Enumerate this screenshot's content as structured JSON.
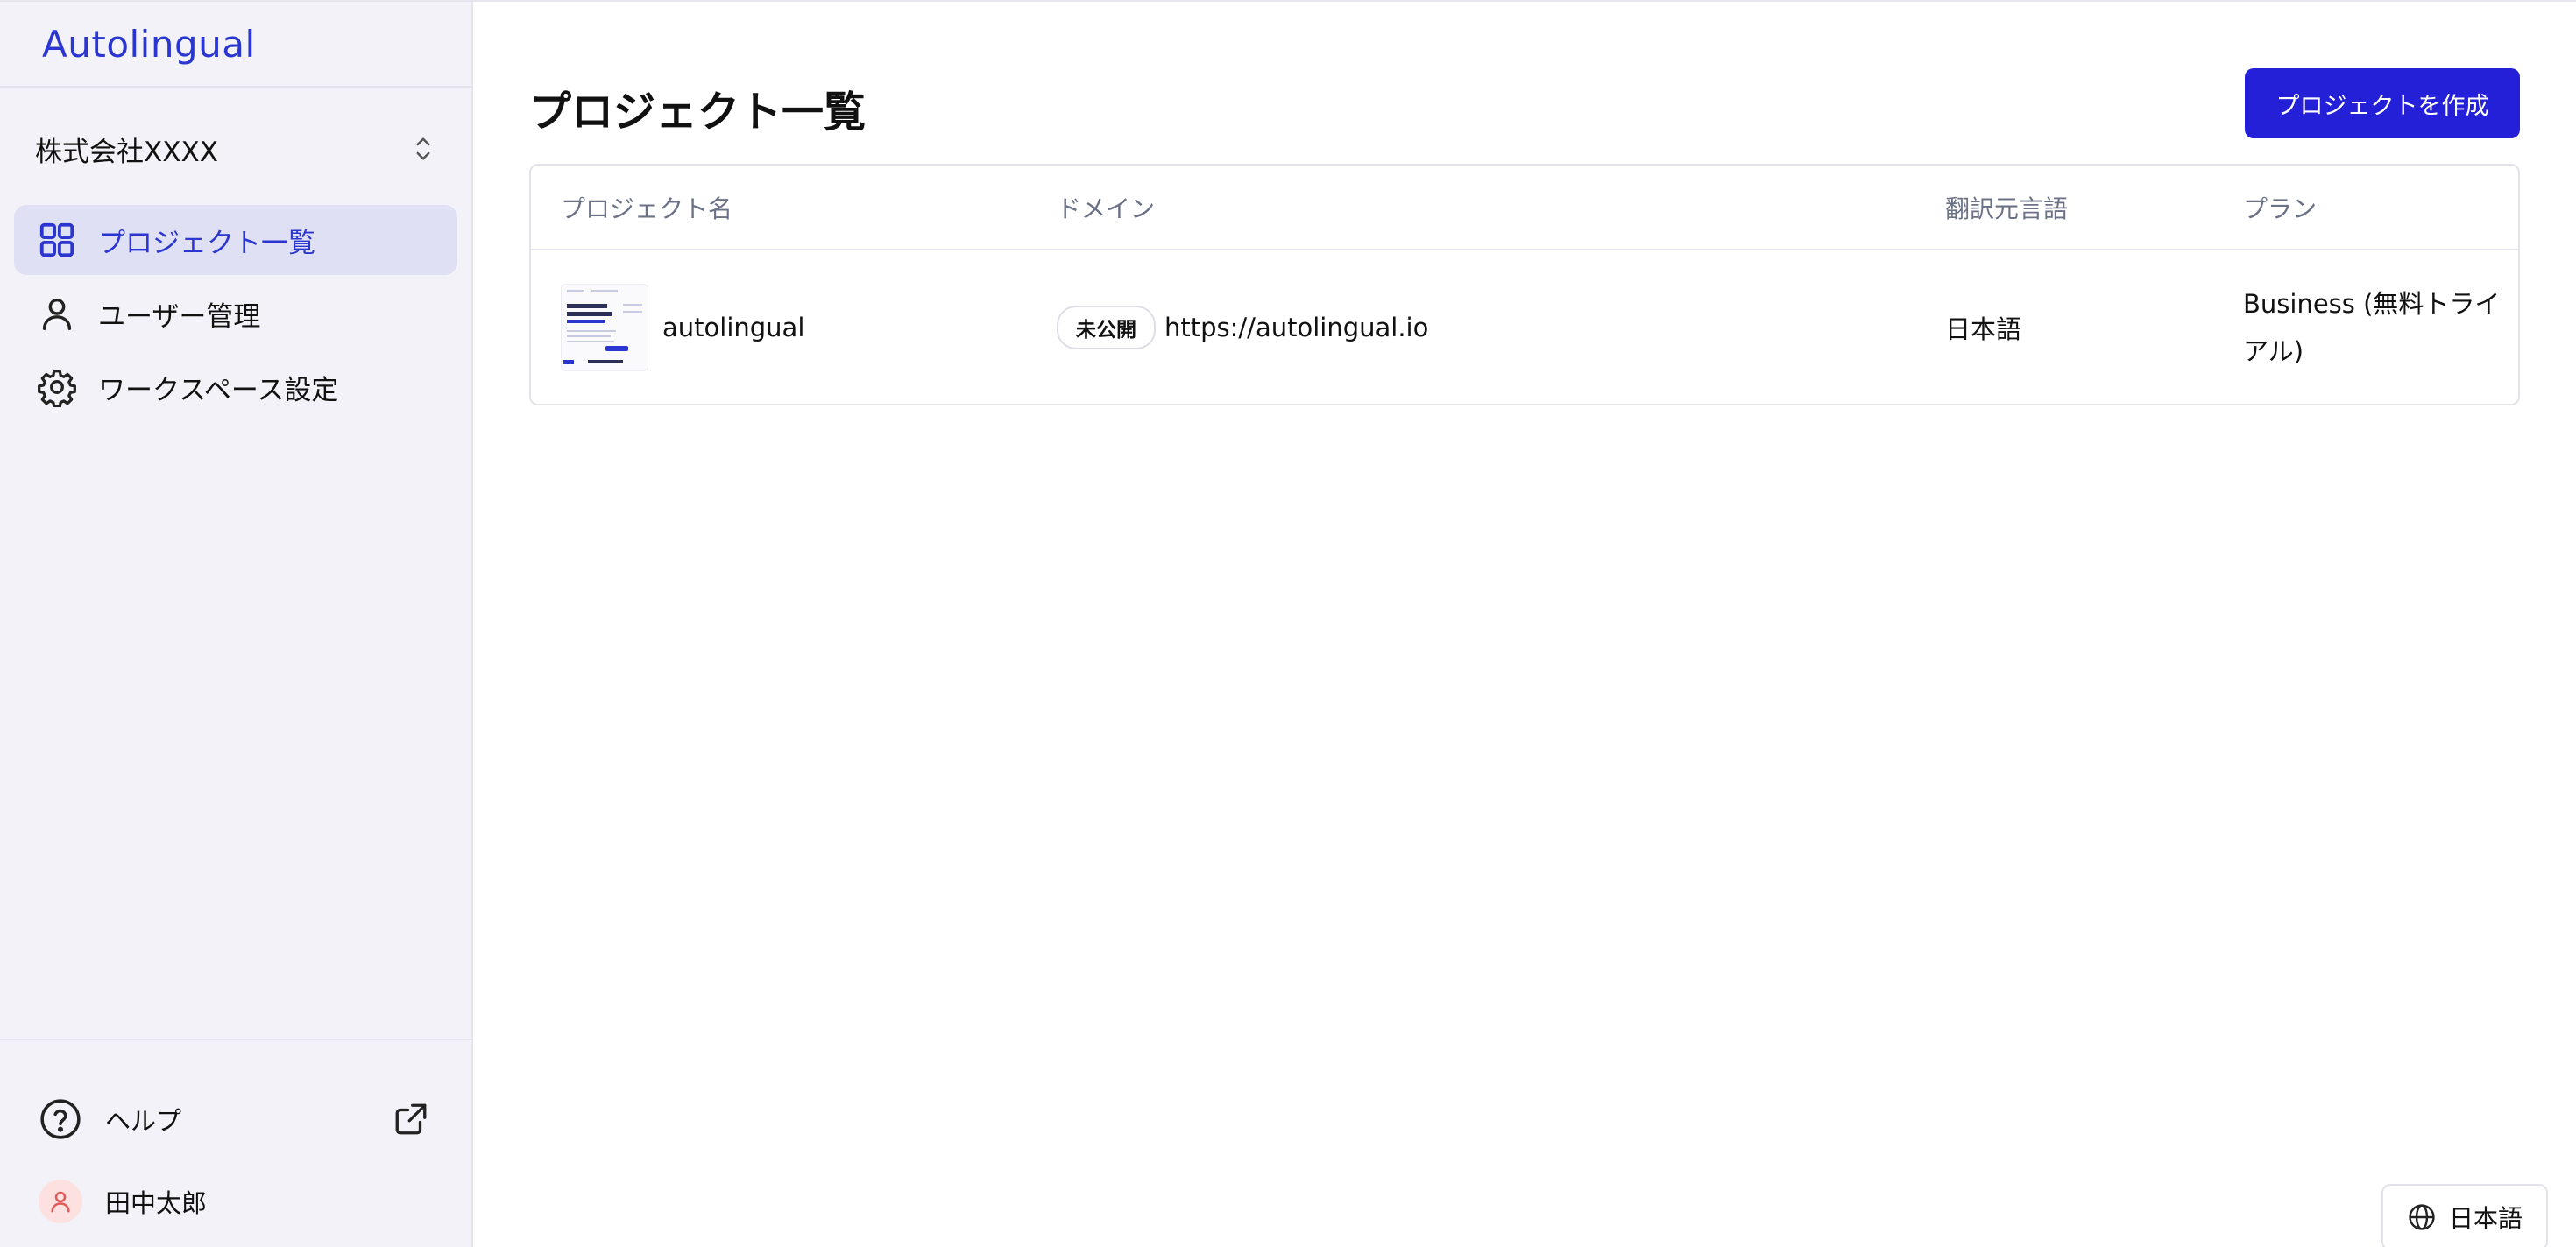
{
  "brand": {
    "logo_text": "Autolingual",
    "accent_color": "#2b36d0"
  },
  "sidebar": {
    "workspace": {
      "name": "株式会社XXXX",
      "icon": "chevron-up-down-icon"
    },
    "items": [
      {
        "label": "プロジェクト一覧",
        "icon": "grid-icon",
        "active": true
      },
      {
        "label": "ユーザー管理",
        "icon": "user-icon",
        "active": false
      },
      {
        "label": "ワークスペース設定",
        "icon": "gear-icon",
        "active": false
      }
    ],
    "help": {
      "label": "ヘルプ",
      "icon": "question-circle-icon",
      "external_icon": "external-link-icon"
    },
    "user": {
      "name": "田中太郎",
      "avatar_icon": "user-icon",
      "avatar_bg": "#fde1e1"
    }
  },
  "main": {
    "title": "プロジェクト一覧",
    "create_button_label": "プロジェクトを作成",
    "primary_color": "#2420d8",
    "table": {
      "columns": [
        "プロジェクト名",
        "ドメイン",
        "翻訳元言語",
        "プラン"
      ],
      "rows": [
        {
          "name": "autolingual",
          "status": "未公開",
          "domain": "https://autolingual.io",
          "source_language": "日本語",
          "plan": "Business (無料トライアル)"
        }
      ]
    }
  },
  "language_switcher": {
    "label": "日本語",
    "icon": "globe-icon"
  }
}
